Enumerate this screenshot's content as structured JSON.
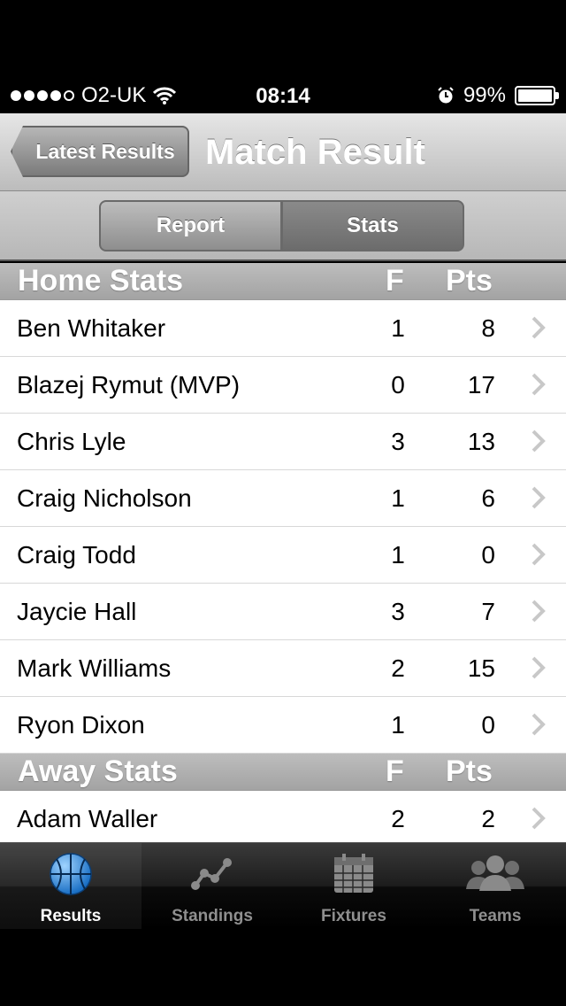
{
  "status_bar": {
    "carrier": "O2-UK",
    "time": "08:14",
    "battery": "99%",
    "battery_level": 0.99,
    "signal_bars": 4,
    "signal_total": 5
  },
  "navbar": {
    "back_label": "Latest Results",
    "title": "Match Result"
  },
  "segments": {
    "report": "Report",
    "stats": "Stats",
    "selected": "Stats"
  },
  "sections": [
    {
      "title": "Home Stats",
      "col_f": "F",
      "col_pts": "Pts",
      "rows": [
        {
          "name": "Ben Whitaker",
          "f": "1",
          "pts": "8"
        },
        {
          "name": "Blazej Rymut (MVP)",
          "f": "0",
          "pts": "17"
        },
        {
          "name": "Chris Lyle",
          "f": "3",
          "pts": "13"
        },
        {
          "name": "Craig Nicholson",
          "f": "1",
          "pts": "6"
        },
        {
          "name": "Craig Todd",
          "f": "1",
          "pts": "0"
        },
        {
          "name": "Jaycie Hall",
          "f": "3",
          "pts": "7"
        },
        {
          "name": "Mark Williams",
          "f": "2",
          "pts": "15"
        },
        {
          "name": "Ryon Dixon",
          "f": "1",
          "pts": "0"
        }
      ]
    },
    {
      "title": "Away Stats",
      "col_f": "F",
      "col_pts": "Pts",
      "rows": [
        {
          "name": "Adam Waller",
          "f": "2",
          "pts": "2"
        }
      ]
    }
  ],
  "tabbar": {
    "tabs": [
      {
        "label": "Results",
        "icon": "basketball-icon",
        "active": true
      },
      {
        "label": "Standings",
        "icon": "line-chart-icon",
        "active": false
      },
      {
        "label": "Fixtures",
        "icon": "calendar-icon",
        "active": false
      },
      {
        "label": "Teams",
        "icon": "people-icon",
        "active": false
      }
    ]
  },
  "colors": {
    "accent_blue": "#3a8fd8",
    "section_gray": "#a9a9a9",
    "tab_inactive": "#8f8f8f"
  }
}
